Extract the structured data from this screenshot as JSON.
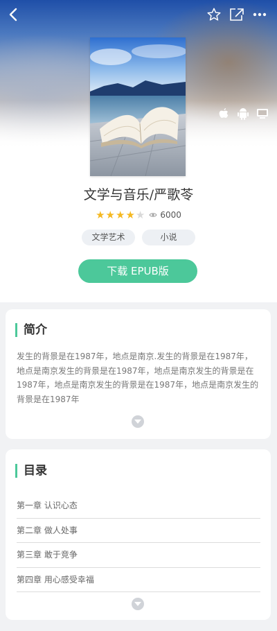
{
  "topbar": {
    "back_icon": "chevron-left-icon",
    "favorite_icon": "star-outline-icon",
    "share_icon": "share-icon",
    "more_icon": "more-dots-icon"
  },
  "platforms": [
    "apple-icon",
    "android-icon",
    "desktop-icon"
  ],
  "book": {
    "title": "文学与音乐/严歌苓",
    "rating_out_of_5": 4,
    "views": "6000",
    "tags": [
      "文学艺术",
      "小说"
    ],
    "download_label": "下载 EPUB版"
  },
  "intro": {
    "heading": "简介",
    "text": "发生的背景是在1987年，地点是南京.发生的背景是在1987年，地点是南京发生的背景是在1987年，地点是南京发生的背景是在1987年，地点是南京发生的背景是在1987年，地点是南京发生的背景是在1987年"
  },
  "toc": {
    "heading": "目录",
    "chapters": [
      "第一章 认识心态",
      "第二章 做人处事",
      "第三章 敢于竞争",
      "第四章 用心感受幸福"
    ]
  },
  "colors": {
    "accent": "#4cc89a",
    "star_on": "#f5b820",
    "star_off": "#d9d9d9"
  }
}
